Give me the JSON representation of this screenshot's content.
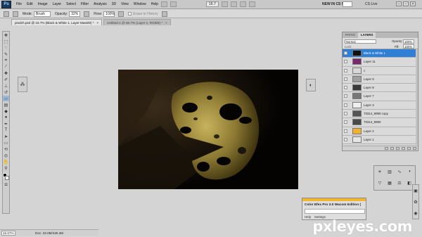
{
  "menubar": {
    "logo": "Ps",
    "items": [
      "File",
      "Edit",
      "Image",
      "Layer",
      "Select",
      "Filter",
      "Analysis",
      "3D",
      "View",
      "Window",
      "Help"
    ],
    "zoom": "16.7",
    "new_in": "NEW IN CS 5",
    "cs_live": "CS Live"
  },
  "options_bar": {
    "mode_label": "Mode:",
    "mode_value": "Brush",
    "opacity_label": "Opacity:",
    "opacity_value": "32%",
    "flow_label": "Flow:",
    "flow_value": "100%",
    "erase_history": "Erase to History"
  },
  "tabs": [
    {
      "label": "pindch.psd @ 16.7% (Black & White 1, Layer Mask/8) *",
      "active": true
    },
    {
      "label": "Untitled-1 @ 66.7% (Layer 1, RGB/8) *",
      "active": false
    }
  ],
  "status": {
    "zoom": "16.67%",
    "doc": "Doc: 23.0M/430.4M"
  },
  "layers_panel": {
    "tabs": [
      "PATHS",
      "LAYERS"
    ],
    "blend_mode": "Normal",
    "opacity_label": "Opacity:",
    "opacity_value": "100%",
    "lock_label": "Lock:",
    "fill_label": "Fill:",
    "fill_value": "100%",
    "layers": [
      {
        "name": "Black & White 1",
        "selected": true,
        "thumb": "#111111"
      },
      {
        "name": "Layer 11",
        "selected": false,
        "thumb": "#7a2a6a"
      },
      {
        "name": "c",
        "selected": false,
        "thumb": "#d8d8d8"
      },
      {
        "name": "Layer 9",
        "selected": false,
        "thumb": "#a0a0a0"
      },
      {
        "name": "Layer 8",
        "selected": false,
        "thumb": "#3a3a3a"
      },
      {
        "name": "Layer 7",
        "selected": false,
        "thumb": "#777777"
      },
      {
        "name": "Layer 3",
        "selected": false,
        "thumb": "#eeeeee"
      },
      {
        "name": "70314_9990 copy",
        "selected": false,
        "thumb": "#555555"
      },
      {
        "name": "70314_9990",
        "selected": false,
        "thumb": "#4a4a4a"
      },
      {
        "name": "Layer 2",
        "selected": false,
        "thumb": "#f0b030"
      },
      {
        "name": "Layer 1",
        "selected": false,
        "thumb": "#e6e6e6"
      }
    ]
  },
  "color_efex": {
    "title": "Color Efex Pro 3.0 Wacom Edition (",
    "help": "Help",
    "settings": "Settings",
    "accent": "#f2b431"
  },
  "watermark": "pxleyes.com"
}
